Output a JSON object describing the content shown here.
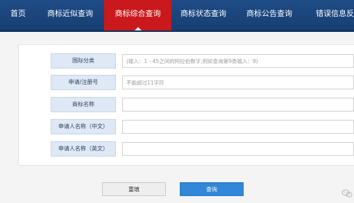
{
  "nav": {
    "items": [
      {
        "label": "首页"
      },
      {
        "label": "商标近似查询"
      },
      {
        "label": "商标综合查询",
        "active": true
      },
      {
        "label": "商标状态查询"
      },
      {
        "label": "商标公告查询"
      },
      {
        "label": "错误信息反馈"
      }
    ]
  },
  "form": {
    "fields": [
      {
        "label": "国际分类",
        "value": "",
        "placeholder": "(输入：1 - 45之间的阿拉伯数字,例如查询第9类输入：9)"
      },
      {
        "label": "申请/注册号",
        "value": "",
        "placeholder": "不能超过11字符"
      },
      {
        "label": "商标名称",
        "value": "",
        "placeholder": ""
      },
      {
        "label": "申请人名称（中文）",
        "value": "",
        "placeholder": ""
      },
      {
        "label": "申请人名称（英文）",
        "value": "",
        "placeholder": ""
      }
    ]
  },
  "buttons": {
    "reset": "重填",
    "search": "查询"
  },
  "colors": {
    "nav_bg": "#1f4d87",
    "nav_active": "#c9191d",
    "label_bg": "#dfe9f6",
    "search_button": "#3187d8"
  }
}
